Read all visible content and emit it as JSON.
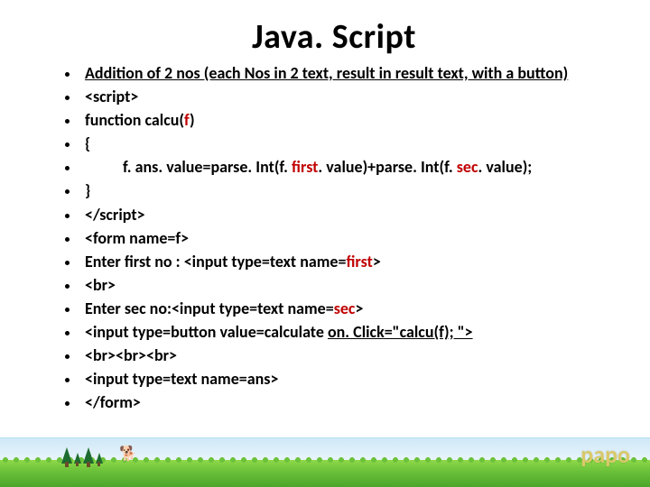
{
  "title": "Java. Script",
  "bullets": {
    "b0_bold_u": "Addition of 2 nos (each Nos in 2 text, result in result text, with a button)",
    "b1": "<script>",
    "b2_pre": "function calcu(",
    "b2_red": "f",
    "b2_post": ")",
    "b3": "{",
    "b4_pre": "f. ans. value=parse. Int(f. ",
    "b4_red1": "first",
    "b4_mid": ". value)+parse. Int(f. ",
    "b4_red2": "sec",
    "b4_post": ". value);",
    "b5": "}",
    "b6": "</script>",
    "b7": "<form name=f>",
    "b8_pre": "Enter first no : <input type=text name=",
    "b8_red": "first",
    "b8_post": ">",
    "b9": "<br>",
    "b10_pre": "Enter sec no:<input type=text name=",
    "b10_red": "sec",
    "b10_post": ">",
    "b11_pre": "<input type=button value=calculate ",
    "b11_bold_u": "on. Click=\"calcu(f); \">",
    "b12": "<br><br><br>",
    "b13": "<input type=text name=ans>",
    "b14": "</form>"
  },
  "footer_label": "papo"
}
